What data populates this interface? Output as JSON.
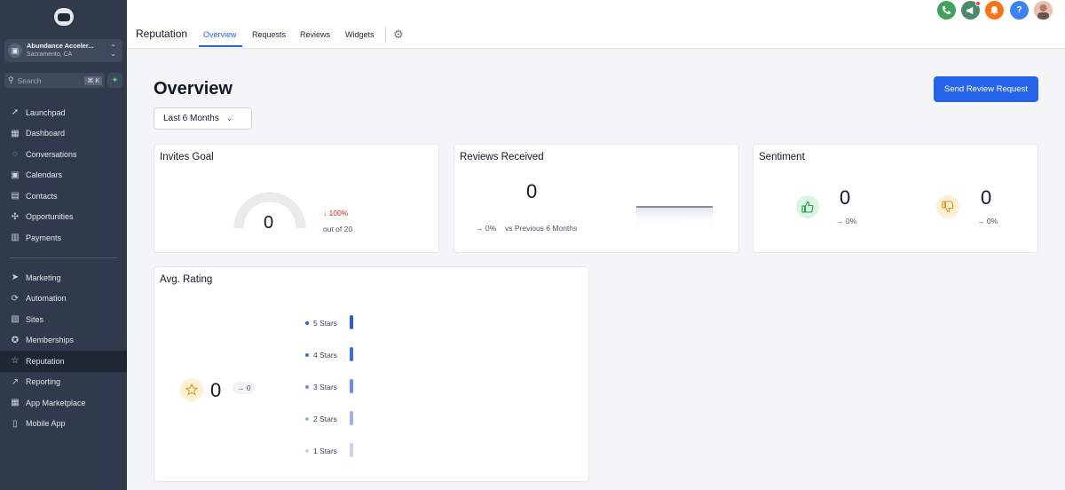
{
  "sidebar": {
    "account": {
      "name": "Abundance Acceler...",
      "location": "Sacramento, CA"
    },
    "search": {
      "placeholder": "Search",
      "shortcut": "⌘ K"
    },
    "items_top": [
      {
        "label": "Launchpad",
        "icon": "rocket-icon"
      },
      {
        "label": "Dashboard",
        "icon": "grid-icon"
      },
      {
        "label": "Conversations",
        "icon": "chat-icon"
      },
      {
        "label": "Calendars",
        "icon": "calendar-icon"
      },
      {
        "label": "Contacts",
        "icon": "contacts-icon"
      },
      {
        "label": "Opportunities",
        "icon": "opportunities-icon"
      },
      {
        "label": "Payments",
        "icon": "payments-icon"
      }
    ],
    "items_bottom": [
      {
        "label": "Marketing",
        "icon": "send-icon"
      },
      {
        "label": "Automation",
        "icon": "automation-icon"
      },
      {
        "label": "Sites",
        "icon": "sites-icon"
      },
      {
        "label": "Memberships",
        "icon": "award-icon"
      },
      {
        "label": "Reputation",
        "icon": "star-icon",
        "active": true
      },
      {
        "label": "Reporting",
        "icon": "trend-icon"
      },
      {
        "label": "App Marketplace",
        "icon": "apps-icon"
      },
      {
        "label": "Mobile App",
        "icon": "mobile-icon"
      }
    ]
  },
  "header": {
    "module_title": "Reputation",
    "tabs": [
      {
        "label": "Overview",
        "active": true
      },
      {
        "label": "Requests"
      },
      {
        "label": "Reviews"
      },
      {
        "label": "Widgets"
      }
    ],
    "action_icons": [
      {
        "name": "phone-icon",
        "color": "#3fa35b"
      },
      {
        "name": "megaphone-icon",
        "color": "#4b8a6b"
      },
      {
        "name": "bell-icon",
        "color": "#f97316"
      },
      {
        "name": "help-icon",
        "color": "#3b82f6",
        "glyph": "?"
      },
      {
        "name": "avatar"
      }
    ]
  },
  "main": {
    "title": "Overview",
    "send_button": "Send Review Request",
    "period": "Last 6 Months",
    "invites_goal": {
      "title": "Invites Goal",
      "value": "0",
      "change": "100%",
      "out_of": "out of 20",
      "progress": 0
    },
    "reviews_received": {
      "title": "Reviews Received",
      "value": "0",
      "change": "0%",
      "comparison": "vs Previous 6 Months"
    },
    "sentiment": {
      "title": "Sentiment",
      "positive": {
        "value": "0",
        "change": "0%"
      },
      "negative": {
        "value": "0",
        "change": "0%"
      }
    },
    "avg_rating": {
      "title": "Avg. Rating",
      "value": "0",
      "change": "0",
      "rows": [
        {
          "label": "5 Stars",
          "color": "#2c5fcf",
          "count": 0
        },
        {
          "label": "4 Stars",
          "color": "#3d70d8",
          "count": 0
        },
        {
          "label": "3 Stars",
          "color": "#6a8fe3",
          "count": 0
        },
        {
          "label": "2 Stars",
          "color": "#98b3ec",
          "count": 0
        },
        {
          "label": "1 Stars",
          "color": "#c3d3f4",
          "count": 0
        }
      ]
    }
  },
  "colors": {
    "accent": "#2563eb",
    "sidebar": "#2f3b4c",
    "down": "#dc2626"
  }
}
